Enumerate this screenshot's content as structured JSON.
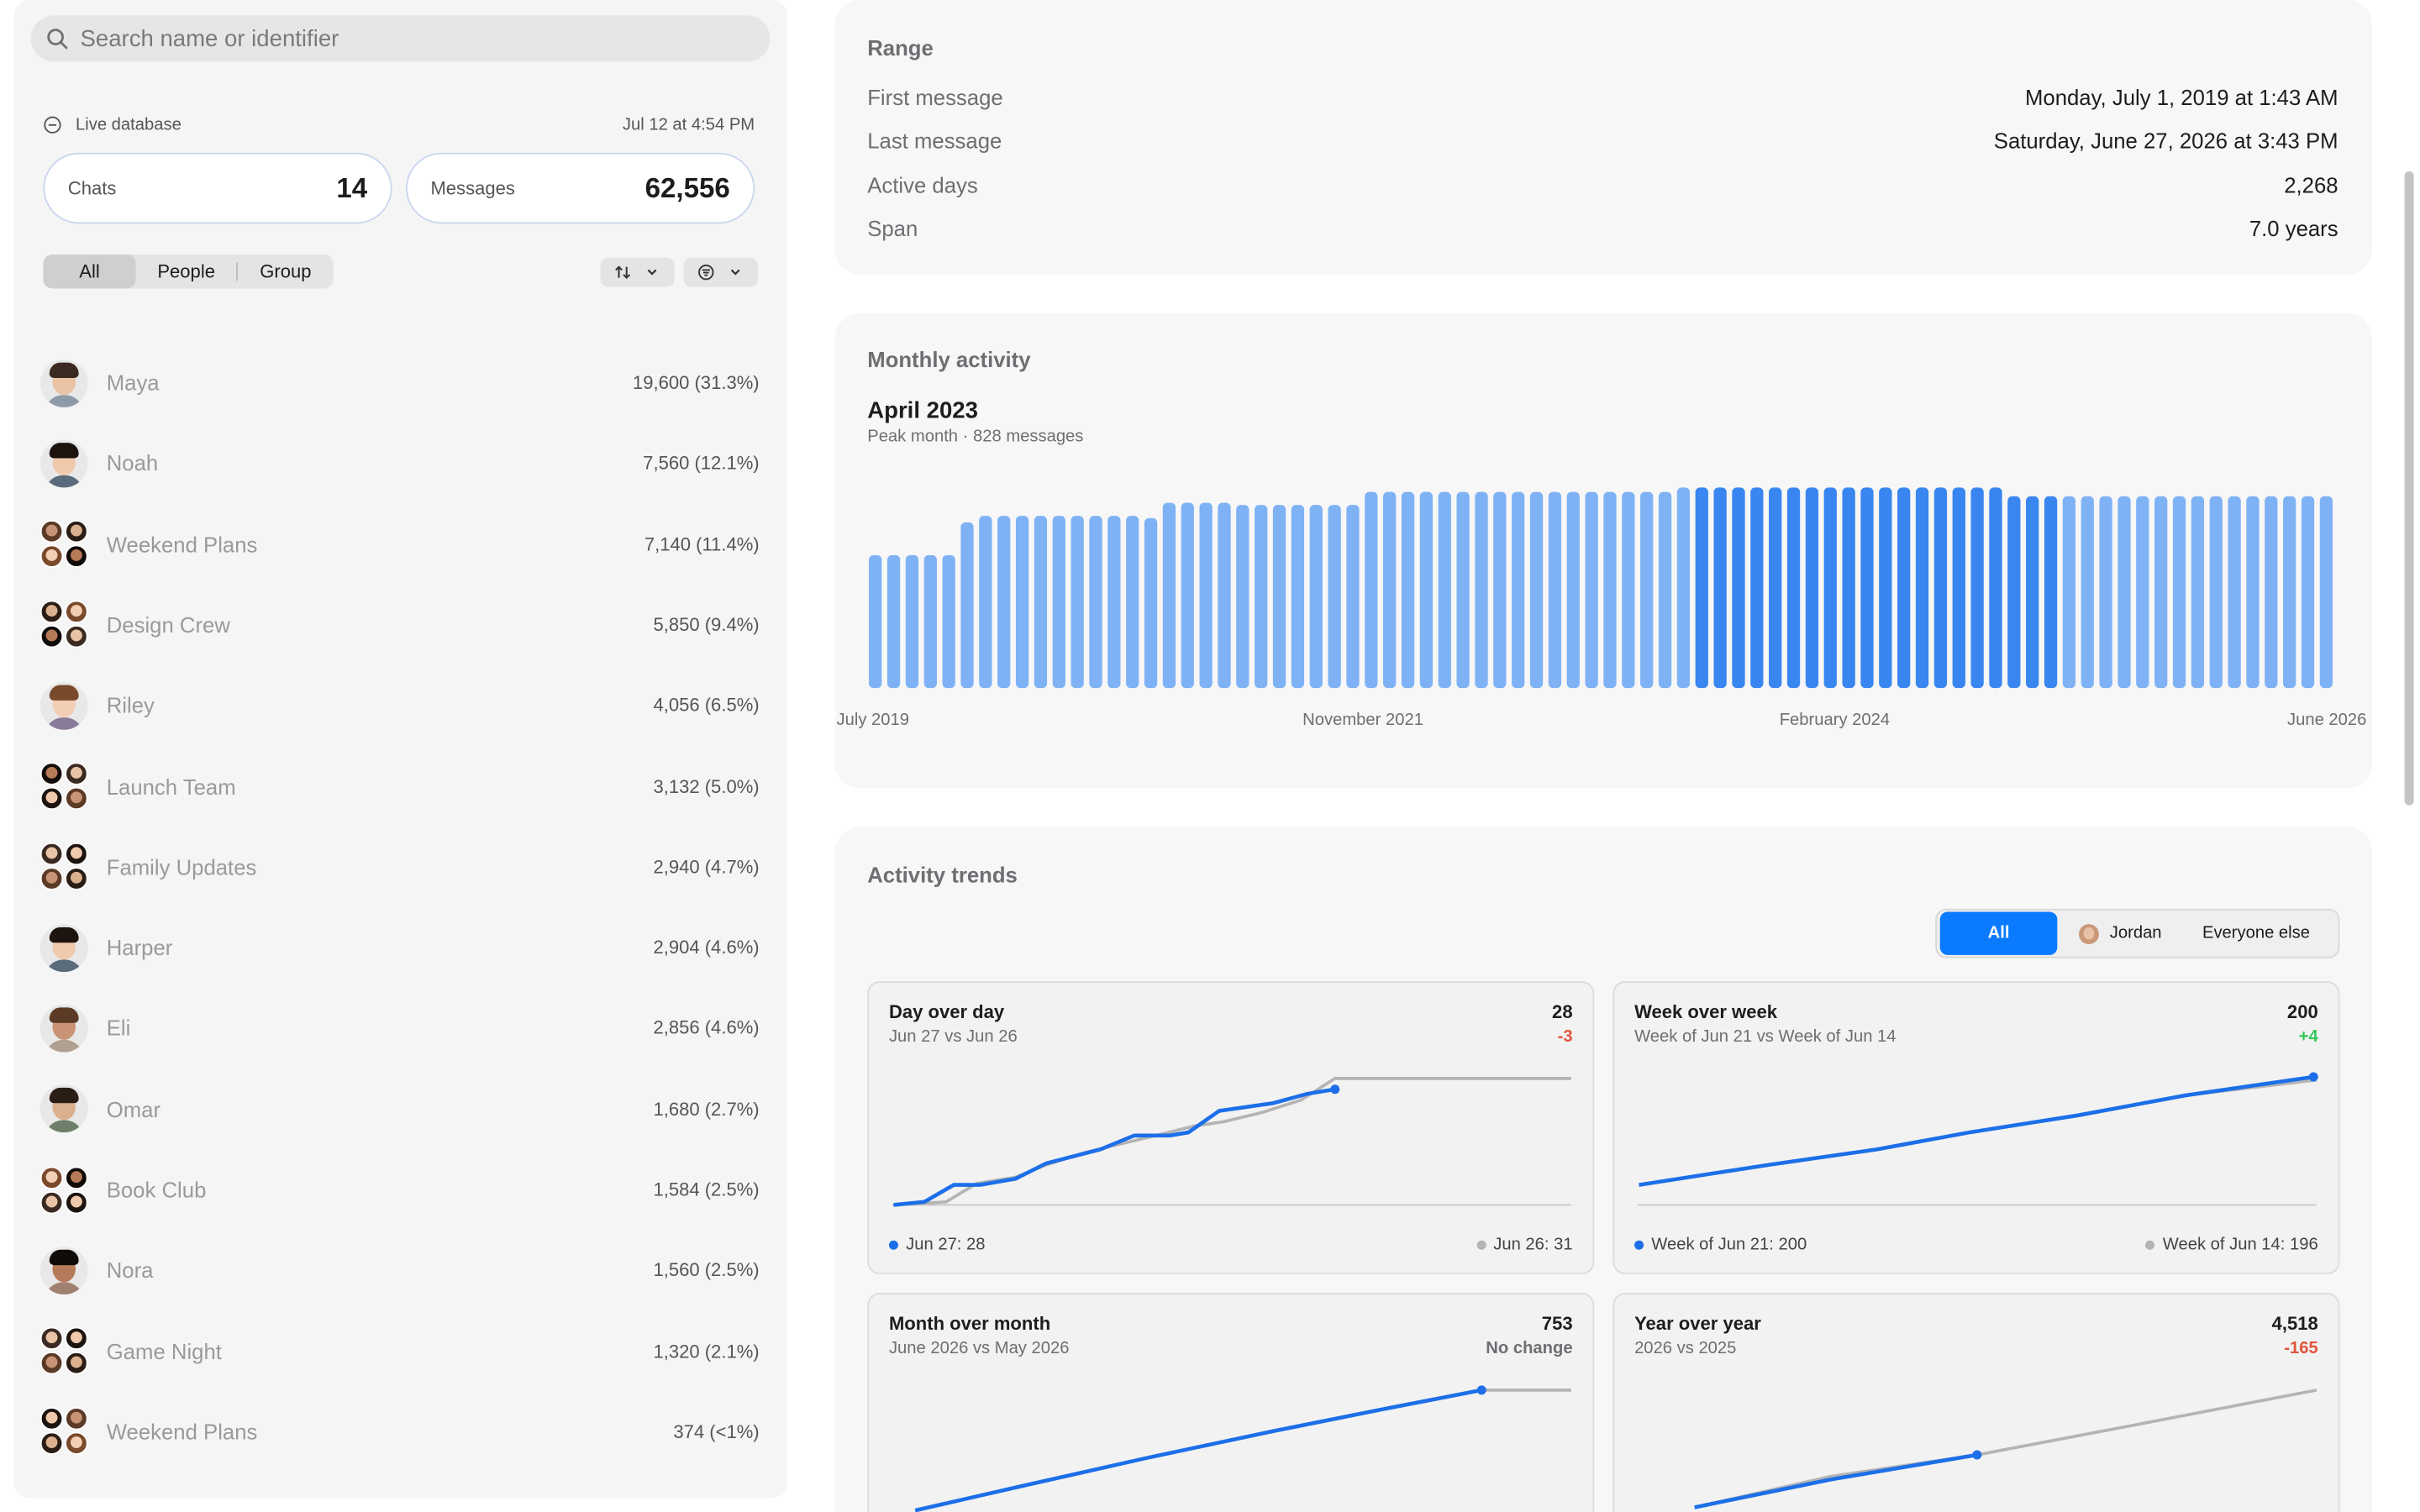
{
  "search": {
    "placeholder": "Search name or identifier"
  },
  "database": {
    "label": "Live database",
    "timestamp": "Jul 12 at 4:54 PM"
  },
  "stats": {
    "chats_label": "Chats",
    "chats_value": "14",
    "messages_label": "Messages",
    "messages_value": "62,556"
  },
  "filters": {
    "all": "All",
    "people": "People",
    "group": "Group"
  },
  "chats": [
    {
      "name": "Maya",
      "count": "19,600 (31.3%)",
      "kind": "person"
    },
    {
      "name": "Noah",
      "count": "7,560 (12.1%)",
      "kind": "person"
    },
    {
      "name": "Weekend Plans",
      "count": "7,140 (11.4%)",
      "kind": "group"
    },
    {
      "name": "Design Crew",
      "count": "5,850 (9.4%)",
      "kind": "group"
    },
    {
      "name": "Riley",
      "count": "4,056 (6.5%)",
      "kind": "person"
    },
    {
      "name": "Launch Team",
      "count": "3,132 (5.0%)",
      "kind": "group"
    },
    {
      "name": "Family Updates",
      "count": "2,940 (4.7%)",
      "kind": "group"
    },
    {
      "name": "Harper",
      "count": "2,904 (4.6%)",
      "kind": "person"
    },
    {
      "name": "Eli",
      "count": "2,856 (4.6%)",
      "kind": "person"
    },
    {
      "name": "Omar",
      "count": "1,680 (2.7%)",
      "kind": "person"
    },
    {
      "name": "Book Club",
      "count": "1,584 (2.5%)",
      "kind": "group"
    },
    {
      "name": "Nora",
      "count": "1,560 (2.5%)",
      "kind": "person"
    },
    {
      "name": "Game Night",
      "count": "1,320 (2.1%)",
      "kind": "group"
    },
    {
      "name": "Weekend Plans",
      "count": "374 (<1%)",
      "kind": "group"
    }
  ],
  "range": {
    "title": "Range",
    "rows": [
      {
        "k": "First message",
        "v": "Monday, July 1, 2019 at 1:43 AM"
      },
      {
        "k": "Last message",
        "v": "Saturday, June 27, 2026 at 3:43 PM"
      },
      {
        "k": "Active days",
        "v": "2,268"
      },
      {
        "k": "Span",
        "v": "7.0 years"
      }
    ]
  },
  "monthly": {
    "title": "Monthly activity",
    "peak_label": "April 2023",
    "peak_sub": "Peak month · 828 messages",
    "axis": [
      "July 2019",
      "November 2021",
      "February 2024",
      "June 2026"
    ]
  },
  "chart_data": {
    "type": "bar",
    "title": "Monthly activity",
    "x_start": "July 2019",
    "x_end": "June 2026",
    "tick_labels": [
      "July 2019",
      "November 2021",
      "February 2024",
      "June 2026"
    ],
    "values": [
      610,
      610,
      610,
      610,
      610,
      760,
      790,
      790,
      790,
      790,
      790,
      790,
      790,
      790,
      790,
      780,
      850,
      850,
      850,
      850,
      840,
      840,
      840,
      840,
      840,
      840,
      840,
      900,
      900,
      900,
      900,
      900,
      900,
      900,
      900,
      900,
      900,
      900,
      900,
      900,
      900,
      900,
      900,
      900,
      920,
      920,
      920,
      920,
      920,
      920,
      920,
      920,
      920,
      920,
      920,
      920,
      920,
      920,
      920,
      920,
      920,
      920,
      880,
      880,
      880,
      880,
      880,
      880,
      880,
      880,
      880,
      880,
      880,
      880,
      880,
      880,
      880,
      880,
      880,
      880
    ],
    "highlight_range": [
      45,
      64
    ],
    "colors": {
      "normal": "#7fb2f5",
      "highlight": "#3a86f0"
    }
  },
  "trends": {
    "title": "Activity trends",
    "seg_all": "All",
    "seg_person": "Jordan",
    "seg_else": "Everyone else",
    "cards": [
      {
        "title": "Day over day",
        "sub": "Jun 27 vs Jun 26",
        "value": "28",
        "delta": "-3",
        "delta_color": "#e0553b",
        "leg_a": "Jun 27: 28",
        "leg_b": "Jun 26: 31"
      },
      {
        "title": "Week over week",
        "sub": "Week of Jun 21 vs Week of Jun 14",
        "value": "200",
        "delta": "+4",
        "delta_color": "#34c759",
        "leg_a": "Week of Jun 21: 200",
        "leg_b": "Week of Jun 14: 196"
      },
      {
        "title": "Month over month",
        "sub": "June 2026 vs May 2026",
        "value": "753",
        "delta": "No change",
        "delta_color": "#6e6e73"
      },
      {
        "title": "Year over year",
        "sub": "2026 vs 2025",
        "value": "4,518",
        "delta": "-165",
        "delta_color": "#e0553b"
      }
    ]
  }
}
